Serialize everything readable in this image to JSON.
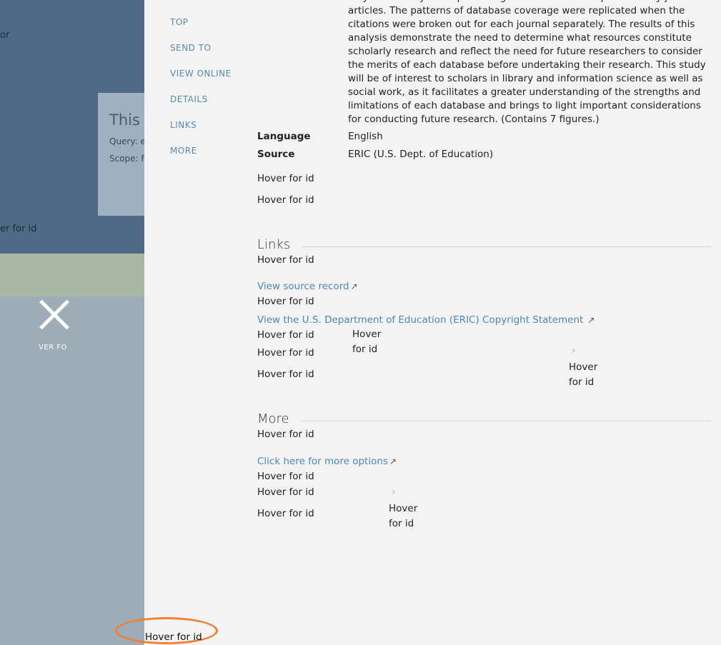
{
  "background": {
    "card_title": "This i",
    "card_query": "Query: e",
    "card_scope": "Scope: F",
    "left_text_top": "or",
    "left_text_hover": "er for id",
    "close_cut_label": "VER FO"
  },
  "nav": {
    "items": [
      "TOP",
      "SEND TO",
      "VIEW ONLINE",
      "DETAILS",
      "LINKS",
      "MORE"
    ]
  },
  "details": {
    "abstract": "only a relatively small percentage of them were unique scholarly journal articles. The patterns of database coverage were replicated when the citations were broken out for each journal separately. The results of this analysis demonstrate the need to determine what resources constitute scholarly research and reflect the need for future researchers to consider the merits of each database before undertaking their research. This study will be of interest to scholars in library and information science as well as social work, as it facilitates a greater understanding of the strengths and limitations of each database and brings to light important considerations for conducting future research. (Contains 7 figures.)",
    "language_label": "Language",
    "language_value": "English",
    "source_label": "Source",
    "source_value": "ERIC (U.S. Dept. of Education)"
  },
  "hover_label": "Hover for id",
  "links_section": {
    "title": "Links",
    "view_source": "View source record",
    "copyright": "View the U.S. Department of Education (ERIC) Copyright Statement"
  },
  "more_section": {
    "title": "More",
    "more_options": "Click here for more options"
  },
  "icons": {
    "external": "external-link-icon",
    "chevron": "chevron-right-icon",
    "close": "close-icon"
  },
  "colors": {
    "link": "#4f86b8",
    "nav": "#5b88b2",
    "annotation": "#f08033"
  }
}
